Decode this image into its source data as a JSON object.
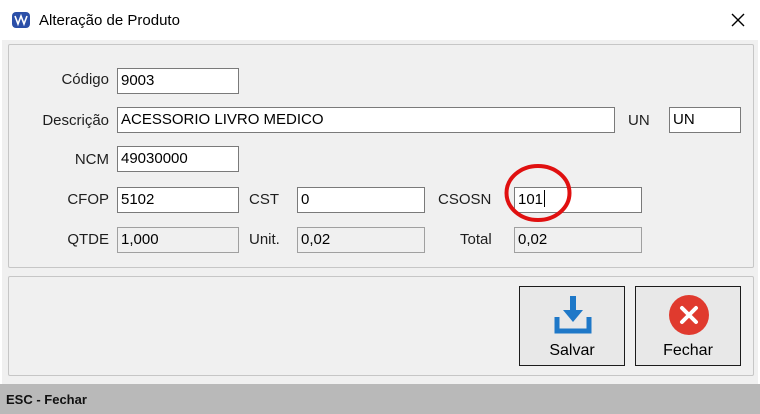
{
  "window": {
    "title": "Alteração de Produto",
    "status_text": "ESC - Fechar"
  },
  "form": {
    "codigo_label": "Código",
    "codigo_value": "9003",
    "descricao_label": "Descrição",
    "descricao_value": "ACESSORIO LIVRO MEDICO",
    "un_label": "UN",
    "un_value": "UN",
    "ncm_label": "NCM",
    "ncm_value": "49030000",
    "cfop_label": "CFOP",
    "cfop_value": "5102",
    "cst_label": "CST",
    "cst_value": "0",
    "csosn_label": "CSOSN",
    "csosn_value": "101",
    "qtde_label": "QTDE",
    "qtde_value": "1,000",
    "unit_label": "Unit.",
    "unit_value": "0,02",
    "total_label": "Total",
    "total_value": "0,02"
  },
  "buttons": {
    "save_label": "Salvar",
    "close_label": "Fechar"
  },
  "colors": {
    "save_icon": "#1e78c8",
    "close_icon": "#e03a2e",
    "highlight": "#e01010"
  },
  "icons": {
    "app": "app-logo-icon",
    "close": "close-icon",
    "save": "save-download-icon",
    "fechar": "cancel-x-icon"
  }
}
